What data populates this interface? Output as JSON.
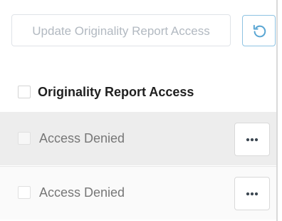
{
  "toolbar": {
    "update_label": "Update Originality Report Access",
    "undo_icon": "undo-icon",
    "undo_color": "#5aa6d3"
  },
  "table": {
    "header": {
      "label": "Originality Report Access",
      "checked": false
    },
    "rows": [
      {
        "label": "Access Denied",
        "checked": false,
        "actions_icon": "more-horizontal-icon"
      },
      {
        "label": "Access Denied",
        "checked": false,
        "actions_icon": "more-horizontal-icon"
      }
    ]
  }
}
